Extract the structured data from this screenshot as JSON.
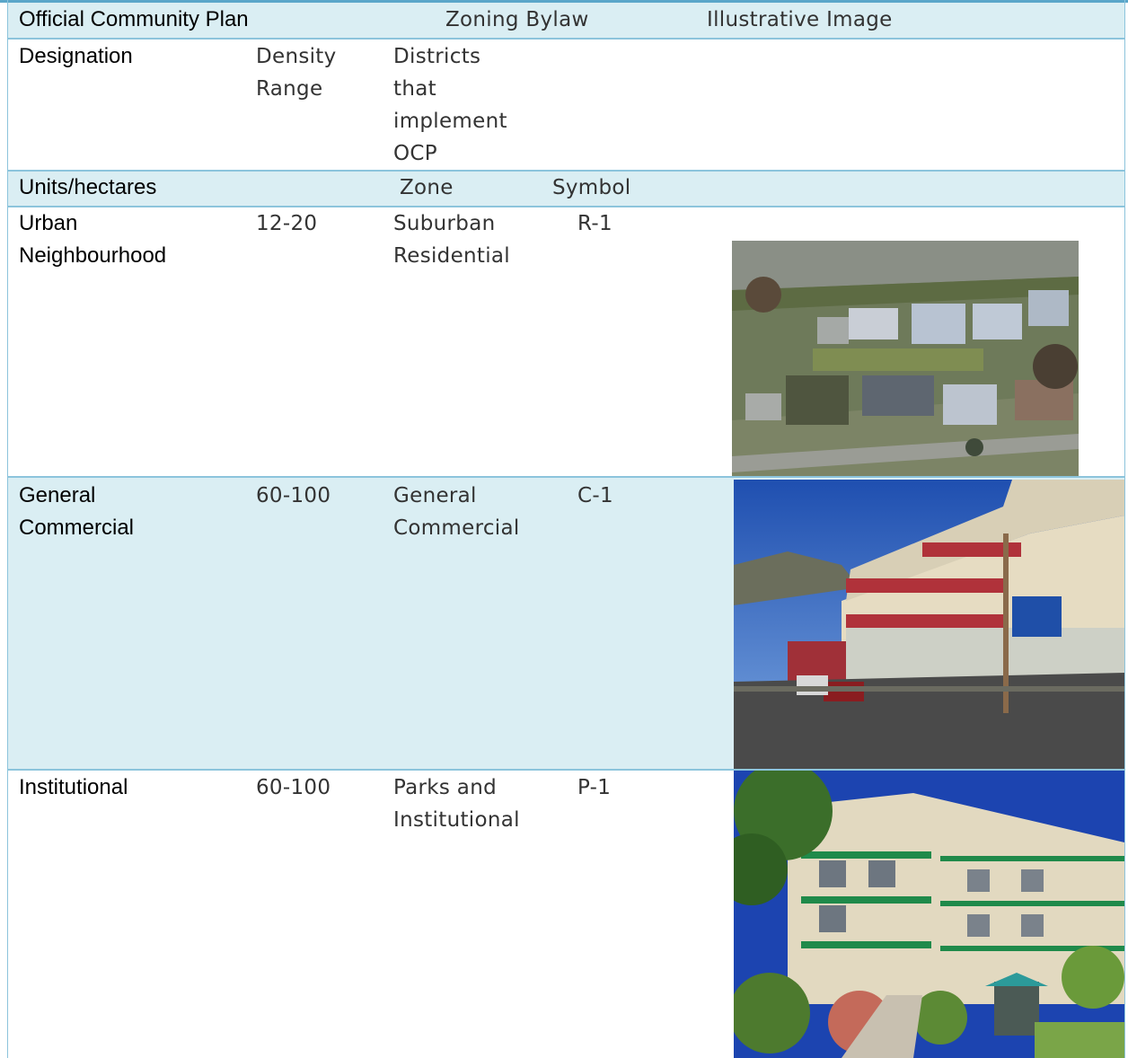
{
  "header": {
    "ocp": "Official Community Plan",
    "zoning": "Zoning Bylaw",
    "image": "Illustrative Image"
  },
  "subheader": {
    "designation": "Designation",
    "density_line1": "Density",
    "density_line2": "Range",
    "districts_line1": "Districts",
    "districts_line2": "that",
    "districts_line3": "implement",
    "districts_line4": "OCP"
  },
  "units_row": {
    "units": "Units/hectares",
    "zone": "Zone",
    "symbol": "Symbol"
  },
  "rows": [
    {
      "designation_line1": "Urban",
      "designation_line2": "Neighbourhood",
      "density": "12-20",
      "zone_line1": "Suburban",
      "zone_line2": "Residential",
      "symbol": "R-1",
      "image_icon": "aerial-residential-photo"
    },
    {
      "designation_line1": "General",
      "designation_line2": "Commercial",
      "density": "60-100",
      "zone_line1": "General",
      "zone_line2": "Commercial",
      "symbol": "C-1",
      "image_icon": "commercial-building-photo"
    },
    {
      "designation_line1": "Institutional",
      "designation_line2": "",
      "density": "60-100",
      "zone_line1": "Parks and",
      "zone_line2": "Institutional",
      "symbol": "P-1",
      "image_icon": "apartment-building-photo"
    }
  ],
  "colors": {
    "header_band": "#daeef3",
    "rule": "#8cc4dc",
    "top_rule": "#5aa6c9"
  }
}
